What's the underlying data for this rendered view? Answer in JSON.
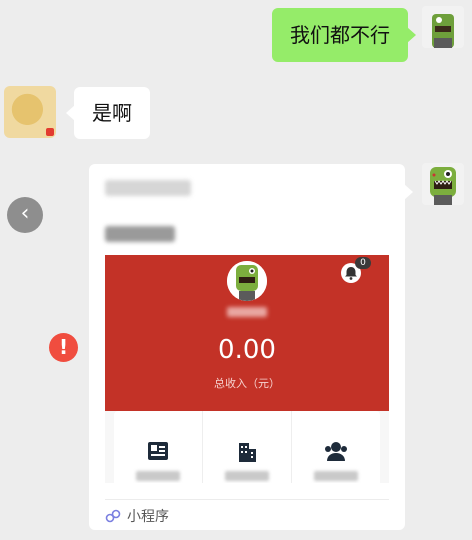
{
  "messages": {
    "sent_text": "我们都不行",
    "received_text": "是啊"
  },
  "mini_program": {
    "income": {
      "value": "0.00",
      "label": "总收入（元）"
    },
    "notification_count": "0",
    "footer_label": "小程序"
  },
  "icons": {
    "back": "chevron-left-icon",
    "error": "exclamation-icon",
    "bell": "bell-icon",
    "profile_card": "id-card-icon",
    "building": "building-icon",
    "users": "users-icon",
    "mini_program": "mini-program-icon"
  },
  "colors": {
    "sent_bubble": "#95ec69",
    "card_accent": "#c33227",
    "error_badge": "#f04d3f",
    "chat_bg": "#ededed"
  }
}
